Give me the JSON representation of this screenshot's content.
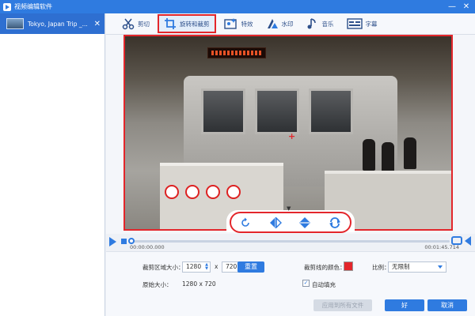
{
  "window": {
    "title": "视频编辑软件",
    "minimize": "—",
    "close": "✕"
  },
  "file_list": {
    "items": [
      {
        "name": "Tokyo, Japan Trip _...",
        "close": "✕"
      }
    ]
  },
  "tabs": [
    {
      "label": "剪切",
      "icon": "scissors-icon"
    },
    {
      "label": "旋转和裁剪",
      "icon": "crop-rotate-icon",
      "active": true
    },
    {
      "label": "特效",
      "icon": "effects-icon"
    },
    {
      "label": "水印",
      "icon": "watermark-icon"
    },
    {
      "label": "音乐",
      "icon": "music-icon"
    },
    {
      "label": "字幕",
      "icon": "subtitle-icon"
    }
  ],
  "controls": [
    {
      "name": "rotate-button",
      "icon": "rotate-icon"
    },
    {
      "name": "flip-horizontal-button",
      "icon": "flip-horizontal-icon"
    },
    {
      "name": "flip-vertical-button",
      "icon": "flip-vertical-icon"
    },
    {
      "name": "reset-button",
      "icon": "reset-icon"
    }
  ],
  "playback": {
    "time_current": "00:00:00.000",
    "time_total": "00:01:45.714",
    "progress": 0.0
  },
  "settings": {
    "crop_size_label": "裁剪区域大小：",
    "width": "1280",
    "times": "x",
    "height": "720",
    "reset_label": "重置",
    "original_size_label": "原始大小：",
    "original_size_value": "1280 x 720",
    "crop_border_color_label": "裁剪线的颜色：",
    "crop_border_color": "#e3262b",
    "ratio_label": "比例：",
    "ratio_value": "无限制",
    "auto_fill_label": "自动填充",
    "auto_fill_checked": true,
    "apply_all_label": "应用到所有文件",
    "ok_label": "好",
    "cancel_label": "取消"
  },
  "colors": {
    "accent": "#2f7be0",
    "highlight": "#e3262b"
  }
}
